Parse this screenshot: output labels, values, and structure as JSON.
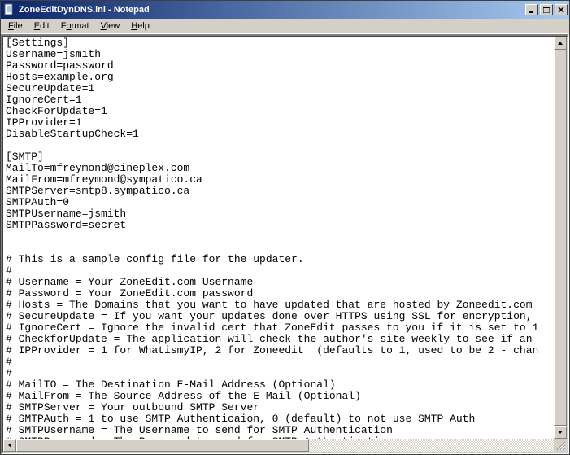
{
  "window": {
    "title": "ZoneEditDynDNS.ini - Notepad"
  },
  "menu": {
    "file": "File",
    "edit": "Edit",
    "format": "Format",
    "view": "View",
    "help": "Help"
  },
  "content": {
    "text": "[Settings]\nUsername=jsmith\nPassword=password\nHosts=example.org\nSecureUpdate=1\nIgnoreCert=1\nCheckForUpdate=1\nIPProvider=1\nDisableStartupCheck=1\n\n[SMTP]\nMailTo=mfreymond@cineplex.com\nMailFrom=mfreymond@sympatico.ca\nSMTPServer=smtp8.sympatico.ca\nSMTPAuth=0\nSMTPUsername=jsmith\nSMTPPassword=secret\n\n\n# This is a sample config file for the updater.\n#\n# Username = Your ZoneEdit.com Username\n# Password = Your ZoneEdit.com password\n# Hosts = The Domains that you want to have updated that are hosted by Zoneedit.com\n# SecureUpdate = If you want your updates done over HTTPS using SSL for encryption,\n# IgnoreCert = Ignore the invalid cert that ZoneEdit passes to you if it is set to 1\n# CheckforUpdate = The application will check the author's site weekly to see if an\n# IPProvider = 1 for WhatismyIP, 2 for Zoneedit  (defaults to 1, used to be 2 - chan\n#\n#\n# MailTO = The Destination E-Mail Address (Optional)\n# MailFrom = The Source Address of the E-Mail (Optional)\n# SMTPServer = Your outbound SMTP Server\n# SMTPAuth = 1 to use SMTP Authenticaion, 0 (default) to not use SMTP Auth\n# SMTPUsername = The Username to send for SMTP Authentication\n# SMTPPassword = The Password to send for SMTP Authentication\n#"
  }
}
